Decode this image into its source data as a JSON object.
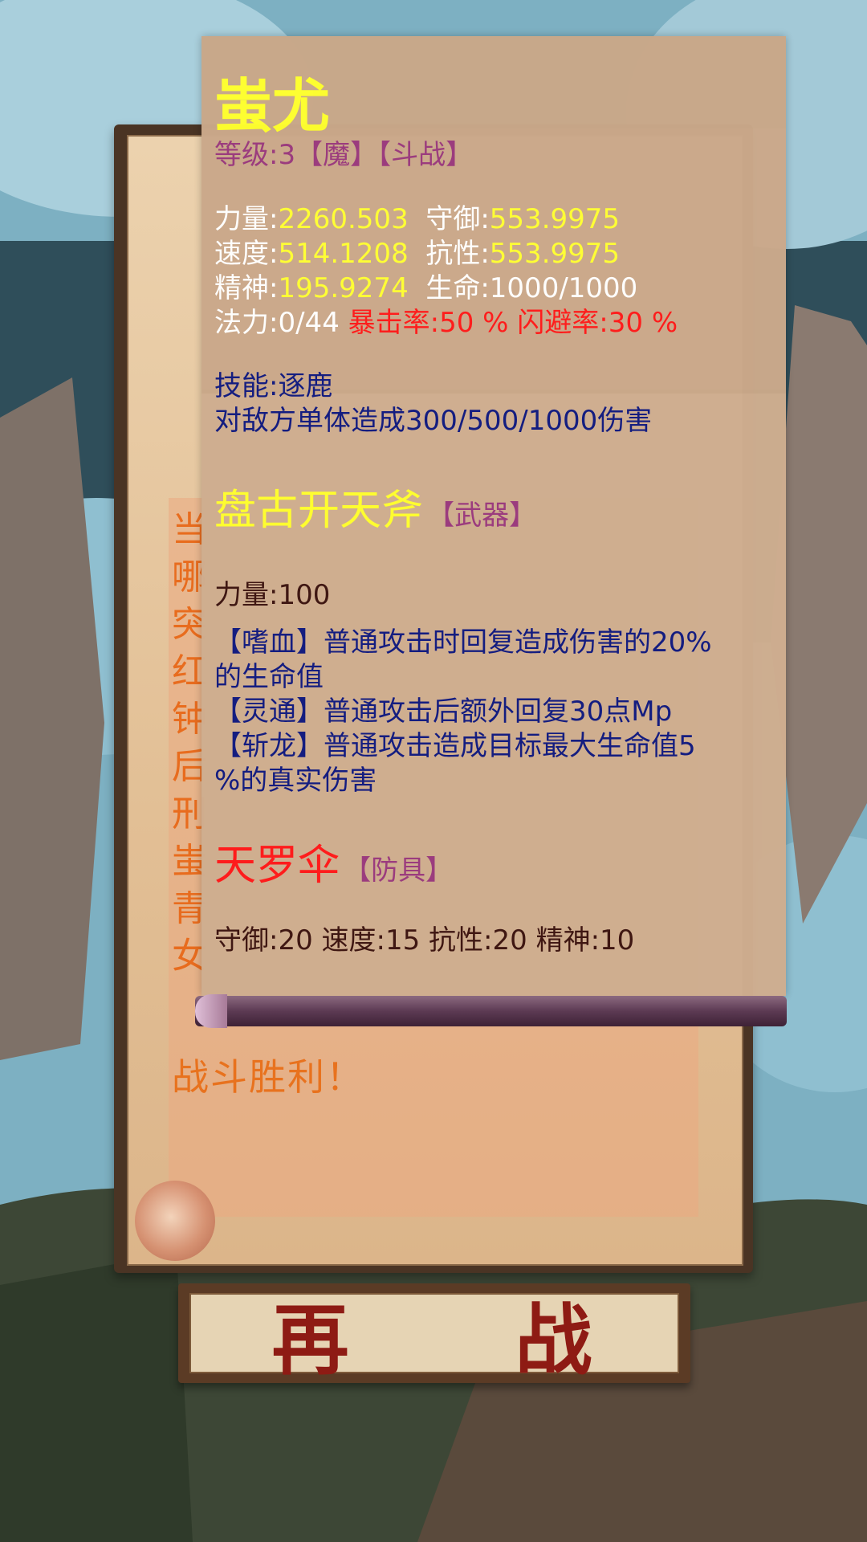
{
  "battle_log": {
    "lines_first_chars": [
      "当",
      "哪",
      "突",
      "红",
      "钟",
      "后",
      "刑",
      "蚩",
      "青",
      "女"
    ],
    "victory": "战斗胜利！"
  },
  "retry_button": {
    "chars": [
      "再",
      "战"
    ]
  },
  "card": {
    "name": "蚩尤",
    "level_line": "等级:3【魔】【斗战】",
    "stats": {
      "strength_label": "力量:",
      "strength": "2260.503",
      "defense_label": "守御:",
      "defense": "553.9975",
      "speed_label": "速度:",
      "speed": "514.1208",
      "resist_label": "抗性:",
      "resist": "553.9975",
      "spirit_label": "精神:",
      "spirit": "195.9274",
      "hp_label": "生命:",
      "hp": "1000/1000",
      "mana_label": "法力:",
      "mana": "0/44",
      "crit": "暴击率:50 %",
      "dodge": "闪避率:30 %"
    },
    "skill_name": "技能:逐鹿",
    "skill_desc": "对敌方单体造成300/500/1000伤害",
    "weapon": {
      "name": "盘古开天斧",
      "type": "【武器】",
      "stats": "力量:100",
      "effects": [
        "【嗜血】普通攻击时回复造成伤害的20%",
        "的生命值",
        "【灵通】普通攻击后额外回复30点Mp",
        "【斩龙】普通攻击造成目标最大生命值5",
        "%的真实伤害"
      ]
    },
    "armor": {
      "name": "天罗伞",
      "type": "【防具】",
      "stats": "守御:20  速度:15  抗性:20  精神:10"
    }
  },
  "colors": {
    "name_yellow": "#ffff2e",
    "stat_value_yellow": "#ffff33",
    "crit_red": "#ff1a1a",
    "skill_blue": "#101a80",
    "tag_purple": "#9a3a7e",
    "log_orange": "#e86c1e"
  }
}
